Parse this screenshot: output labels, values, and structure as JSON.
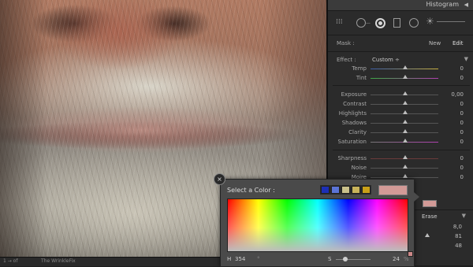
{
  "panel": {
    "histogram_title": "Histogram",
    "mask_label": "Mask :",
    "mask_new": "New",
    "mask_edit": "Edit",
    "effect_label": "Effect :",
    "effect_value": "Custom ÷",
    "sliders": [
      {
        "label": "Temp",
        "value": "0"
      },
      {
        "label": "Tint",
        "value": "0"
      },
      {
        "label": "Exposure",
        "value": "0,00"
      },
      {
        "label": "Contrast",
        "value": "0"
      },
      {
        "label": "Highlights",
        "value": "0"
      },
      {
        "label": "Shadows",
        "value": "0"
      },
      {
        "label": "Clarity",
        "value": "0"
      },
      {
        "label": "Saturation",
        "value": "0"
      },
      {
        "label": "Sharpness",
        "value": "0"
      },
      {
        "label": "Noise",
        "value": "0"
      },
      {
        "label": "Moire",
        "value": "0"
      }
    ],
    "lower": {
      "erase_label": "Erase",
      "values": [
        "8,0",
        "81",
        "48"
      ]
    }
  },
  "picker": {
    "title": "Select a Color :",
    "swatch_colors": [
      "#1c2fb5",
      "#5b74d6",
      "#c9c08a",
      "#c8b35a",
      "#c9a018"
    ],
    "current_color": "#d29a97",
    "h_label": "H",
    "h_value": "354",
    "h_unit": "°",
    "s_label": "S",
    "s_value": "24",
    "s_unit": "%",
    "close_glyph": "×"
  },
  "filmstrip": {
    "left_text": "1 → of",
    "mid_text": "The WrinkleFix"
  }
}
